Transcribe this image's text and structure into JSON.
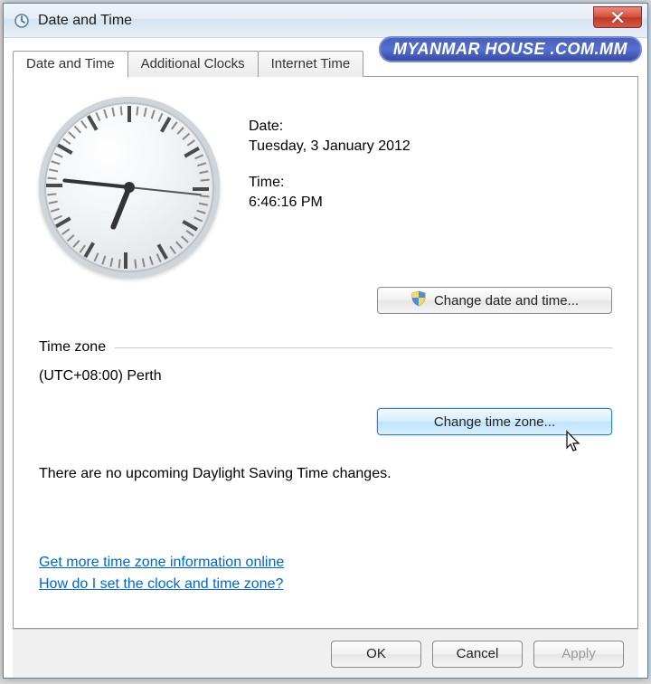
{
  "window": {
    "title": "Date and Time"
  },
  "watermark": "MYANMAR HOUSE .COM.MM",
  "tabs": {
    "date_time": "Date and Time",
    "additional_clocks": "Additional Clocks",
    "internet_time": "Internet Time"
  },
  "main": {
    "date_label": "Date:",
    "date_value": "Tuesday, 3 January 2012",
    "time_label": "Time:",
    "time_value": "6:46:16 PM",
    "change_datetime_btn": "Change date and time...",
    "timezone_header": "Time zone",
    "timezone_value": "(UTC+08:00) Perth",
    "change_timezone_btn": "Change time zone...",
    "dst_note": "There are no upcoming Daylight Saving Time changes.",
    "link_more_info": "Get more time zone information online",
    "link_howto": "How do I set the clock and time zone?"
  },
  "clock": {
    "hour_angle": 202,
    "minute_angle": 276,
    "second_angle": 96
  },
  "footer": {
    "ok": "OK",
    "cancel": "Cancel",
    "apply": "Apply"
  }
}
